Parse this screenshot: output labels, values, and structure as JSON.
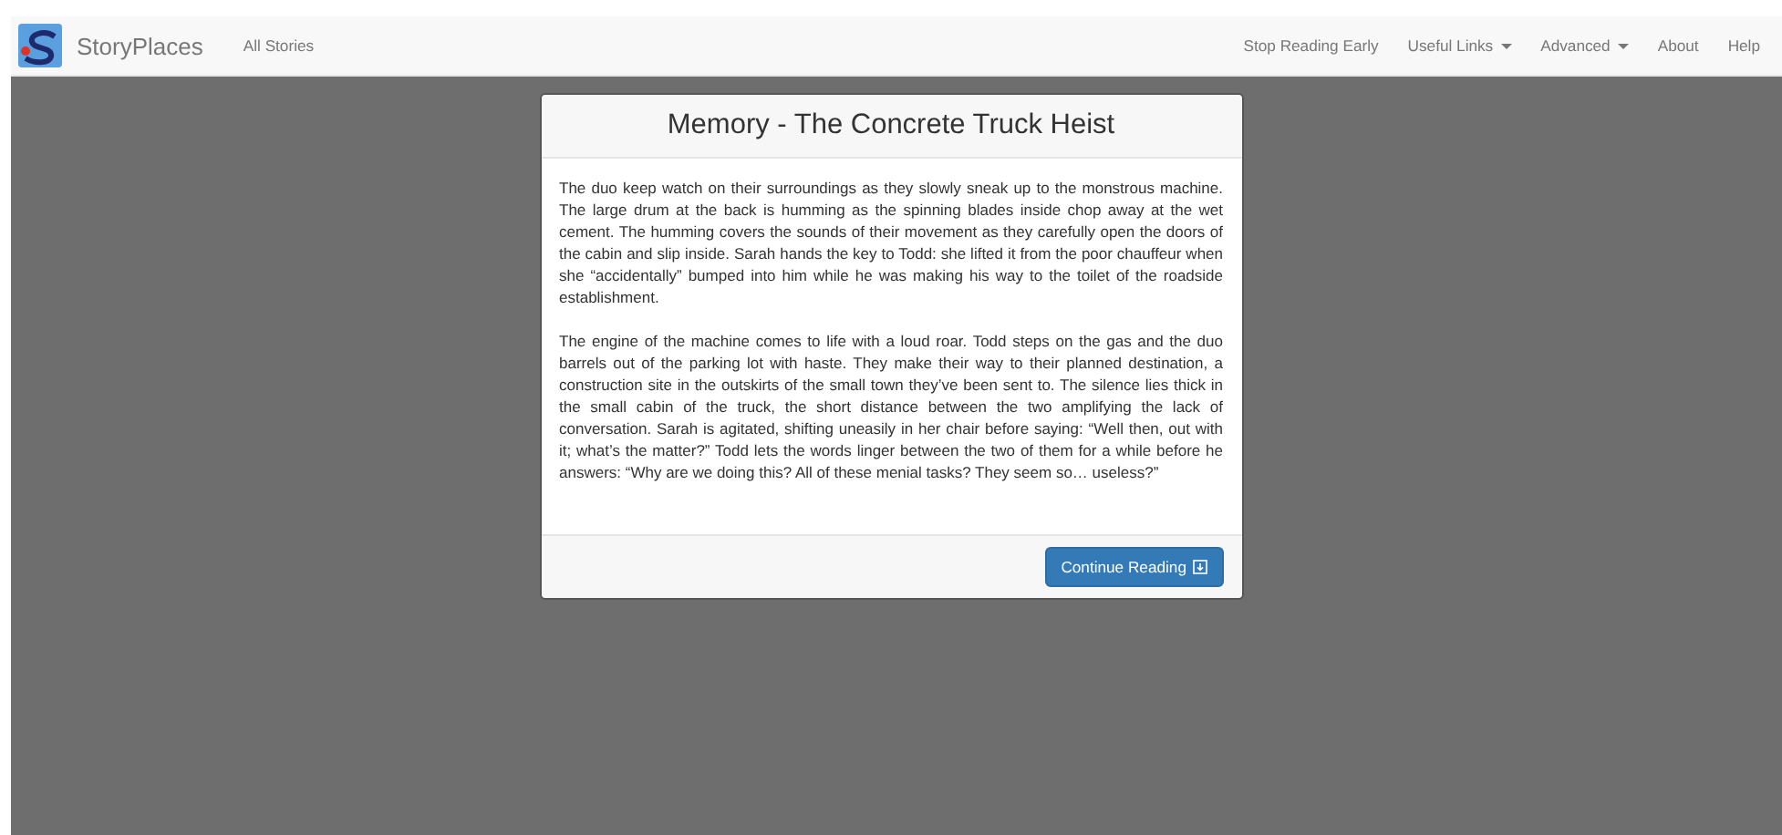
{
  "navbar": {
    "brand": "StoryPlaces",
    "left_links": [
      {
        "label": "All Stories",
        "dropdown": false
      }
    ],
    "right_links": [
      {
        "label": "Stop Reading Early",
        "dropdown": false
      },
      {
        "label": "Useful Links",
        "dropdown": true
      },
      {
        "label": "Advanced",
        "dropdown": true
      },
      {
        "label": "About",
        "dropdown": false
      },
      {
        "label": "Help",
        "dropdown": false
      }
    ]
  },
  "modal": {
    "title": "Memory - The Concrete Truck Heist",
    "paragraphs": [
      "The duo keep watch on their surroundings as they slowly sneak up to the monstrous machine. The large drum at the back is humming as the spinning blades inside chop away at the wet cement. The humming covers the sounds of their movement as they carefully open the doors of the cabin and slip inside. Sarah hands the key to Todd: she lifted it from the poor chauffeur when she “accidentally” bumped into him while he was making his way to the toilet of the roadside establishment.",
      "The engine of the machine comes to life with a loud roar. Todd steps on the gas and the duo barrels out of the parking lot with haste. They make their way to their planned destination, a construction site in the outskirts of the small town they’ve been sent to. The silence lies thick in the small cabin of the truck, the short distance between the two amplifying the lack of conversation. Sarah is agitated, shifting uneasily in her chair before saying: “Well then, out with it; what’s the matter?” Todd lets the words linger between the two of them for a while before he answers: “Why are we doing this? All of these menial tasks? They seem so… useless?”"
    ],
    "button": "Continue Reading"
  }
}
